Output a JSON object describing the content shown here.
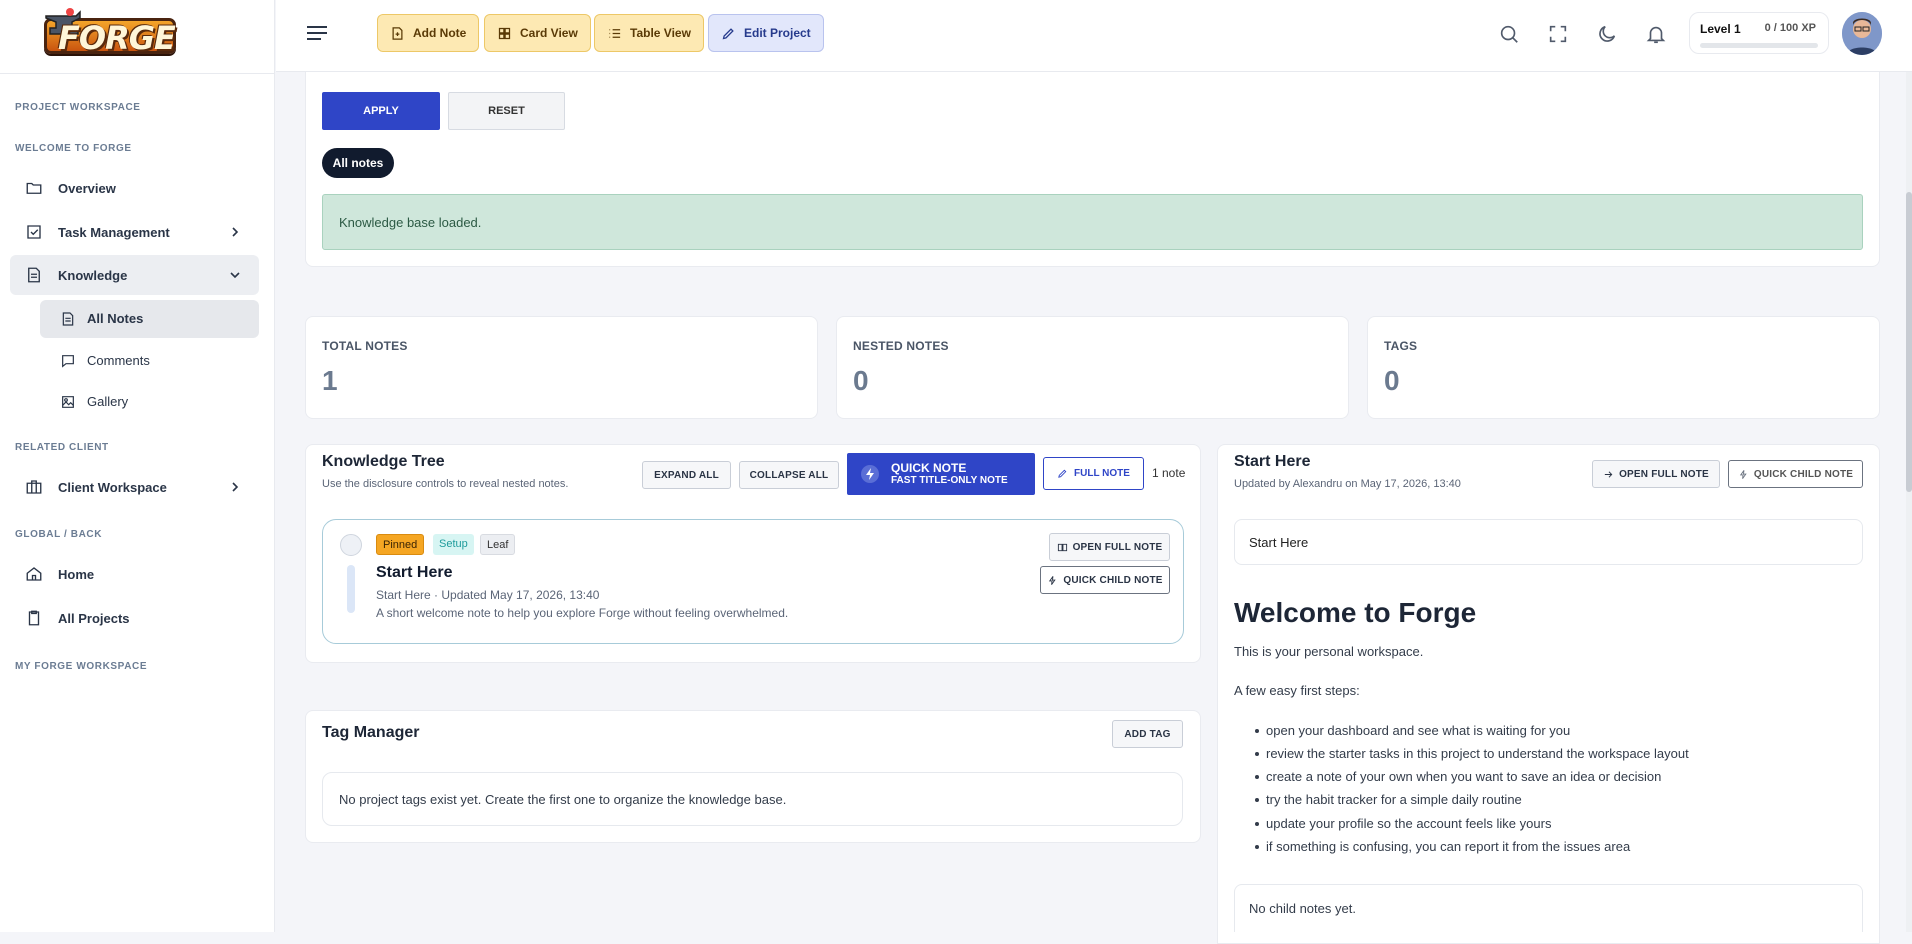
{
  "sidebar": {
    "logo_text": "FORGE",
    "section_project": "PROJECT WORKSPACE",
    "section_welcome": "WELCOME TO FORGE",
    "items": {
      "overview": "Overview",
      "tasks": "Task Management",
      "knowledge": "Knowledge",
      "all_notes": "All Notes",
      "comments": "Comments",
      "gallery": "Gallery",
      "client_workspace": "Client Workspace",
      "home": "Home",
      "all_projects": "All Projects"
    },
    "section_related": "RELATED CLIENT",
    "section_global": "GLOBAL / BACK",
    "section_my": "MY FORGE WORKSPACE"
  },
  "toolbar": {
    "add_note": "Add Note",
    "card_view": "Card View",
    "table_view": "Table View",
    "edit_project": "Edit Project"
  },
  "xp": {
    "level": "Level 1",
    "points": "0 / 100 XP",
    "progress": 0
  },
  "filters": {
    "apply": "APPLY",
    "reset": "RESET",
    "active_pill": "All notes",
    "alert": "Knowledge base loaded."
  },
  "stats": [
    {
      "label": "TOTAL NOTES",
      "value": "1"
    },
    {
      "label": "NESTED NOTES",
      "value": "0"
    },
    {
      "label": "TAGS",
      "value": "0"
    }
  ],
  "tree": {
    "title": "Knowledge Tree",
    "subtitle": "Use the disclosure controls to reveal nested notes.",
    "expand_all": "EXPAND ALL",
    "collapse_all": "COLLAPSE ALL",
    "quick_note": "QUICK NOTE",
    "quick_note_sub": "FAST TITLE-ONLY NOTE",
    "full_note": "FULL NOTE",
    "count": "1 note",
    "note": {
      "badges": [
        "Pinned",
        "Setup",
        "Leaf"
      ],
      "title": "Start Here",
      "meta": "Start Here · Updated May 17, 2026, 13:40",
      "description": "A short welcome note to help you explore Forge without feeling overwhelmed.",
      "open_full": "OPEN FULL NOTE",
      "quick_child": "QUICK CHILD NOTE"
    }
  },
  "tags": {
    "title": "Tag Manager",
    "add_tag": "ADD TAG",
    "empty": "No project tags exist yet. Create the first one to organize the knowledge base."
  },
  "detail": {
    "title": "Start Here",
    "updated": "Updated by Alexandru on May 17, 2026, 13:40",
    "open_full": "OPEN FULL NOTE",
    "quick_child": "QUICK CHILD NOTE",
    "field_value": "Start Here",
    "heading": "Welcome to Forge",
    "intro": "This is your personal workspace.",
    "steps_label": "A few easy first steps:",
    "steps": [
      "open your dashboard and see what is waiting for you",
      "review the starter tasks in this project to understand the workspace layout",
      "create a note of your own when you want to save an idea or decision",
      "try the habit tracker for a simple daily routine",
      "update your profile so the account feels like yours",
      "if something is confusing, you can report it from the issues area"
    ],
    "no_children": "No child notes yet."
  },
  "colors": {
    "primary": "#2f45c7",
    "pinned": "#f5a623",
    "setup": "#2ec4c4",
    "alert": "#cfe7db"
  }
}
